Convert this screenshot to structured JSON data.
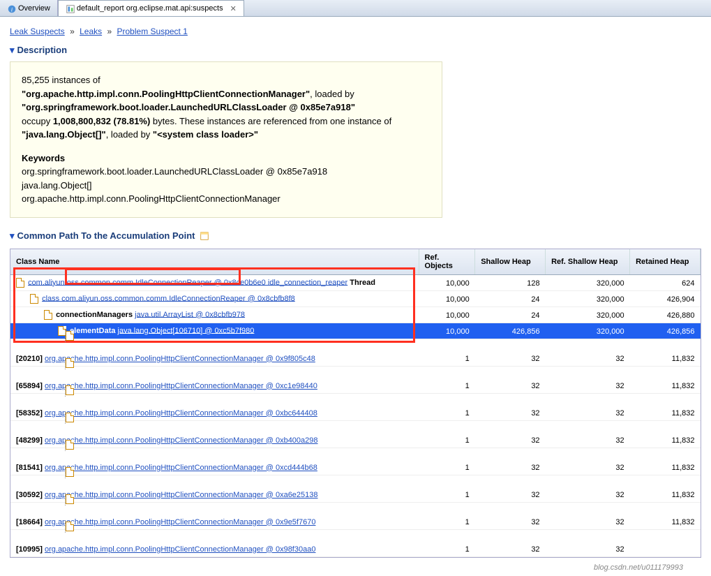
{
  "tabs": [
    {
      "icon": "info",
      "label": "Overview"
    },
    {
      "icon": "report",
      "label": "default_report  org.eclipse.mat.api:suspects",
      "close": true
    }
  ],
  "breadcrumb": [
    {
      "text": "Leak Suspects"
    },
    {
      "text": "Leaks"
    },
    {
      "text": "Problem Suspect 1"
    }
  ],
  "sections": {
    "description": "Description",
    "common_path": "Common Path To the Accumulation Point"
  },
  "desc": {
    "instances_count": "85,255",
    "instances_text": " instances of",
    "class_name": "\"org.apache.http.impl.conn.PoolingHttpClientConnectionManager\"",
    "loaded_by": ", loaded by",
    "loader": "\"org.springframework.boot.loader.LaunchedURLClassLoader @ 0x85e7a918\"",
    "occupy_pre": "occupy ",
    "occupy_bytes": "1,008,800,832 (78.81%)",
    "occupy_post": " bytes. These instances are referenced from one instance of ",
    "ref_class": "\"java.lang.Object[]\"",
    "ref_post": ", loaded by ",
    "sys_loader": "\"<system class loader>\"",
    "kw_hdr": "Keywords",
    "kw1": "org.springframework.boot.loader.LaunchedURLClassLoader @ 0x85e7a918",
    "kw2": "java.lang.Object[]",
    "kw3": "org.apache.http.impl.conn.PoolingHttpClientConnectionManager"
  },
  "columns": {
    "class_name": "Class Name",
    "ref_objects": "Ref. Objects",
    "shallow": "Shallow Heap",
    "ref_shallow": "Ref. Shallow Heap",
    "retained": "Retained Heap"
  },
  "rows": [
    {
      "indent": 0,
      "prefix": "",
      "link": "com.aliyun.oss.common.comm.IdleConnectionReaper @ 0x8ce0b6e0 idle_connection_reaper",
      "suffix": " Thread",
      "ro": "10,000",
      "sh": "128",
      "rsh": "320,000",
      "rh": "624",
      "sel": false
    },
    {
      "indent": 1,
      "prefix": "<class> ",
      "link": "class com.aliyun.oss.common.comm.IdleConnectionReaper @ 0x8cbfb8f8",
      "suffix": "",
      "ro": "10,000",
      "sh": "24",
      "rsh": "320,000",
      "rh": "426,904",
      "sel": false
    },
    {
      "indent": 2,
      "prefix": "connectionManagers ",
      "link": "java.util.ArrayList @ 0x8cbfb978",
      "suffix": "",
      "ro": "10,000",
      "sh": "24",
      "rsh": "320,000",
      "rh": "426,880",
      "sel": false
    },
    {
      "indent": 3,
      "prefix": "elementData ",
      "link": "java.lang.Object[106710] @ 0xc5b7f980",
      "suffix": "",
      "ro": "10,000",
      "sh": "426,856",
      "rsh": "320,000",
      "rh": "426,856",
      "sel": true
    },
    {
      "indent": 0,
      "idx": "[20210]",
      "link": "org.apache.http.impl.conn.PoolingHttpClientConnectionManager @ 0x9f805c48",
      "ro": "1",
      "sh": "32",
      "rsh": "32",
      "rh": "11,832",
      "sel": false,
      "leaf": true
    },
    {
      "indent": 0,
      "idx": "[65894]",
      "link": "org.apache.http.impl.conn.PoolingHttpClientConnectionManager @ 0xc1e98440",
      "ro": "1",
      "sh": "32",
      "rsh": "32",
      "rh": "11,832",
      "sel": false,
      "leaf": true
    },
    {
      "indent": 0,
      "idx": "[58352]",
      "link": "org.apache.http.impl.conn.PoolingHttpClientConnectionManager @ 0xbc644408",
      "ro": "1",
      "sh": "32",
      "rsh": "32",
      "rh": "11,832",
      "sel": false,
      "leaf": true
    },
    {
      "indent": 0,
      "idx": "[48299]",
      "link": "org.apache.http.impl.conn.PoolingHttpClientConnectionManager @ 0xb400a298",
      "ro": "1",
      "sh": "32",
      "rsh": "32",
      "rh": "11,832",
      "sel": false,
      "leaf": true
    },
    {
      "indent": 0,
      "idx": "[81541]",
      "link": "org.apache.http.impl.conn.PoolingHttpClientConnectionManager @ 0xcd444b68",
      "ro": "1",
      "sh": "32",
      "rsh": "32",
      "rh": "11,832",
      "sel": false,
      "leaf": true
    },
    {
      "indent": 0,
      "idx": "[30592]",
      "link": "org.apache.http.impl.conn.PoolingHttpClientConnectionManager @ 0xa6e25138",
      "ro": "1",
      "sh": "32",
      "rsh": "32",
      "rh": "11,832",
      "sel": false,
      "leaf": true
    },
    {
      "indent": 0,
      "idx": "[18664]",
      "link": "org.apache.http.impl.conn.PoolingHttpClientConnectionManager @ 0x9e5f7670",
      "ro": "1",
      "sh": "32",
      "rsh": "32",
      "rh": "11,832",
      "sel": false,
      "leaf": true
    },
    {
      "indent": 0,
      "idx": "[10995]",
      "link": "org.apache.http.impl.conn.PoolingHttpClientConnectionManager @ 0x98f30aa0",
      "ro": "1",
      "sh": "32",
      "rsh": "32",
      "rh": "",
      "sel": false,
      "leaf": true
    }
  ],
  "watermark": "blog.csdn.net/u011179993"
}
